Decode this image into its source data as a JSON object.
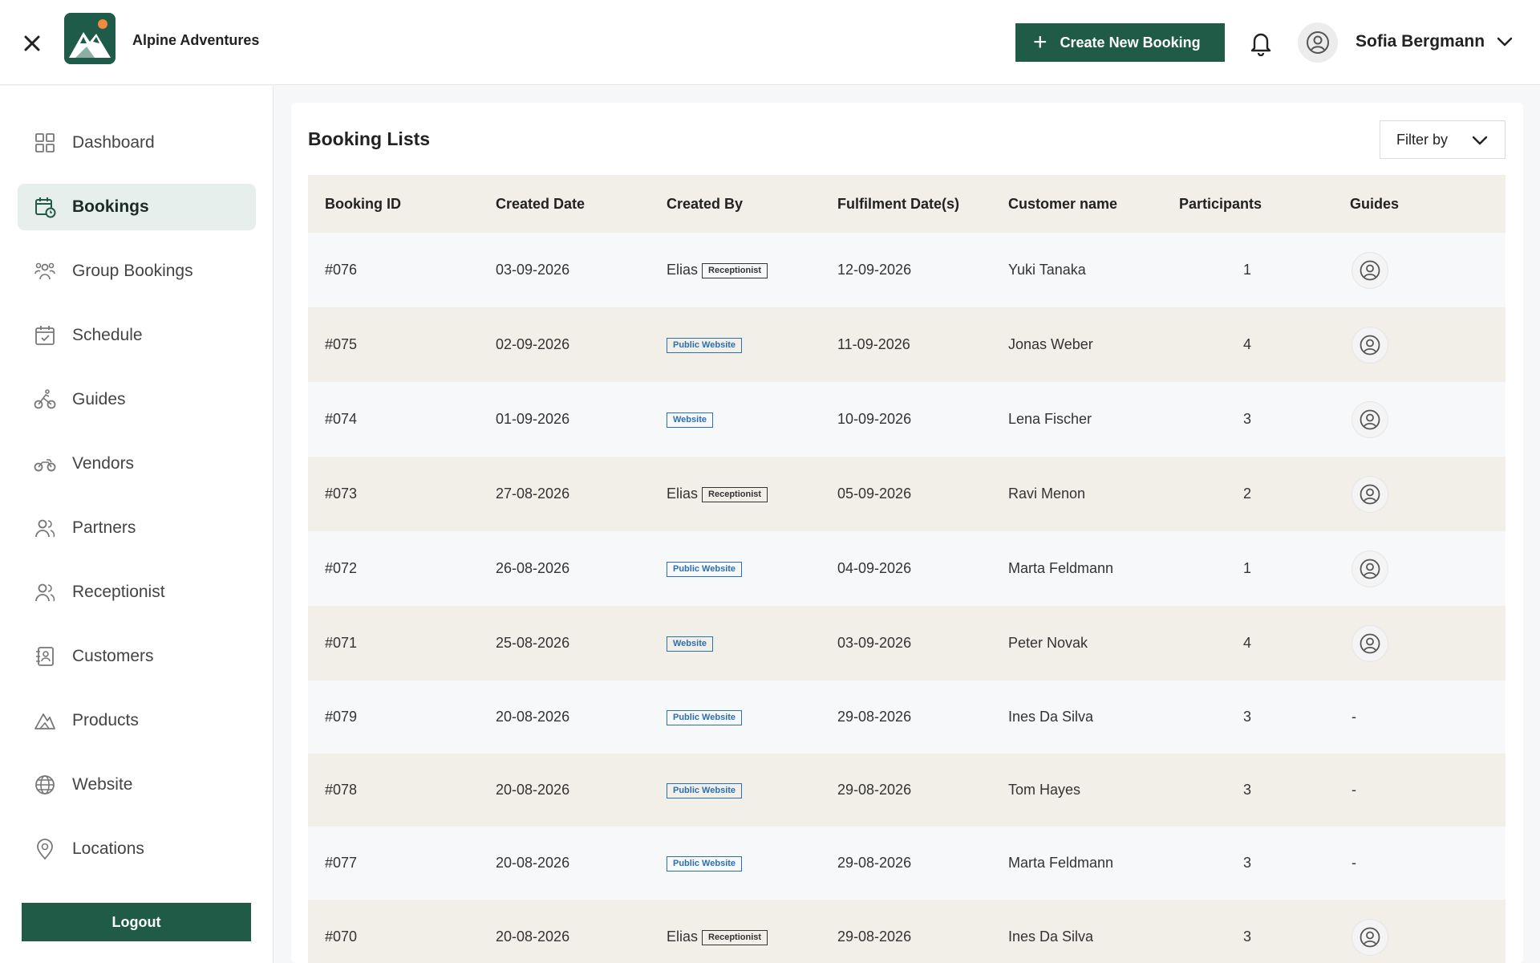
{
  "app": {
    "name": "Alpine Adventures"
  },
  "header": {
    "create_label": "Create New Booking",
    "user_name": "Sofia Bergmann"
  },
  "sidebar": {
    "items": [
      {
        "label": "Dashboard",
        "icon": "dashboard-icon"
      },
      {
        "label": "Bookings",
        "icon": "calendar-clock-icon",
        "active": true
      },
      {
        "label": "Group Bookings",
        "icon": "group-icon"
      },
      {
        "label": "Schedule",
        "icon": "calendar-check-icon"
      },
      {
        "label": "Guides",
        "icon": "bike-rider-icon"
      },
      {
        "label": "Vendors",
        "icon": "motorbike-icon"
      },
      {
        "label": "Partners",
        "icon": "users-icon"
      },
      {
        "label": "Receptionist",
        "icon": "users-icon"
      },
      {
        "label": "Customers",
        "icon": "contact-book-icon"
      },
      {
        "label": "Products",
        "icon": "mountain-icon"
      },
      {
        "label": "Website",
        "icon": "globe-icon"
      },
      {
        "label": "Locations",
        "icon": "map-pin-icon"
      }
    ],
    "logout_label": "Logout"
  },
  "main": {
    "title": "Booking Lists",
    "filter_label": "Filter by",
    "columns": [
      "Booking ID",
      "Created Date",
      "Created By",
      "Fulfilment Date(s)",
      "Customer name",
      "Participants",
      "Guides"
    ],
    "rows": [
      {
        "id": "#076",
        "created": "03-09-2026",
        "by_name": "Elias",
        "by_badge": "Receptionist",
        "fulfil": "12-09-2026",
        "customer": "Yuki Tanaka",
        "participants": "1",
        "guide": "avatar"
      },
      {
        "id": "#075",
        "created": "02-09-2026",
        "by_name": "",
        "by_badge": "Public Website",
        "fulfil": "11-09-2026",
        "customer": "Jonas Weber",
        "participants": "4",
        "guide": "avatar"
      },
      {
        "id": "#074",
        "created": "01-09-2026",
        "by_name": "",
        "by_badge": "Website",
        "fulfil": "10-09-2026",
        "customer": "Lena Fischer",
        "participants": "3",
        "guide": "avatar"
      },
      {
        "id": "#073",
        "created": "27-08-2026",
        "by_name": "Elias",
        "by_badge": "Receptionist",
        "fulfil": "05-09-2026",
        "customer": "Ravi Menon",
        "participants": "2",
        "guide": "avatar"
      },
      {
        "id": "#072",
        "created": "26-08-2026",
        "by_name": "",
        "by_badge": "Public Website",
        "fulfil": "04-09-2026",
        "customer": "Marta Feldmann",
        "participants": "1",
        "guide": "avatar"
      },
      {
        "id": "#071",
        "created": "25-08-2026",
        "by_name": "",
        "by_badge": "Website",
        "fulfil": "03-09-2026",
        "customer": "Peter Novak",
        "participants": "4",
        "guide": "avatar"
      },
      {
        "id": "#079",
        "created": "20-08-2026",
        "by_name": "",
        "by_badge": "Public Website",
        "fulfil": "29-08-2026",
        "customer": "Ines Da Silva",
        "participants": "3",
        "guide": "-"
      },
      {
        "id": "#078",
        "created": "20-08-2026",
        "by_name": "",
        "by_badge": "Public Website",
        "fulfil": "29-08-2026",
        "customer": "Tom Hayes",
        "participants": "3",
        "guide": "-"
      },
      {
        "id": "#077",
        "created": "20-08-2026",
        "by_name": "",
        "by_badge": "Public Website",
        "fulfil": "29-08-2026",
        "customer": "Marta Feldmann",
        "participants": "3",
        "guide": "-"
      },
      {
        "id": "#070",
        "created": "20-08-2026",
        "by_name": "Elias",
        "by_badge": "Receptionist",
        "fulfil": "29-08-2026",
        "customer": "Ines Da Silva",
        "participants": "3",
        "guide": "avatar"
      }
    ]
  },
  "colors": {
    "brand": "#1f5b47",
    "row_alt": "#f2efe8",
    "row_base": "#f7f8fa",
    "web_badge": "#2a6fb5"
  }
}
